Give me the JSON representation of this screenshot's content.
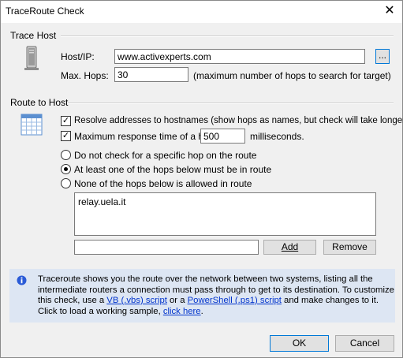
{
  "window": {
    "title": "TraceRoute Check",
    "close_glyph": "✕"
  },
  "trace_host": {
    "section_label": "Trace Host",
    "host_label": "Host/IP:",
    "host_value": "www.activexperts.com",
    "browse_label": "...",
    "hops_label": "Max. Hops:",
    "hops_value": "30",
    "hops_hint": "(maximum number of hops to search for target)"
  },
  "route": {
    "section_label": "Route to Host",
    "resolve_label": "Resolve addresses to hostnames (show hops as names, but check will take longer)",
    "resolve_checked": true,
    "max_time_label": "Maximum response time of a hop:",
    "max_time_checked": true,
    "max_time_value": "500",
    "max_time_unit": "milliseconds.",
    "radio_options": [
      {
        "label": "Do not check for a specific hop on the route",
        "selected": false
      },
      {
        "label": "At least one of the hops below must be in route",
        "selected": true
      },
      {
        "label": "None of the hops below is allowed in route",
        "selected": false
      }
    ],
    "hops_list": [
      "relay.uela.it"
    ],
    "new_hop_value": "",
    "add_label": "Add",
    "remove_label": "Remove"
  },
  "info": {
    "line1": "Traceroute shows you the route over the network between two systems, listing all the",
    "line2": "intermediate routers a connection must pass through to get to its destination. To customize",
    "line3_pre": "this check, use a ",
    "vb_link": "VB (.vbs) script",
    "line3_mid": " or a ",
    "ps_link": "PowerShell (.ps1) script",
    "line3_post": " and make changes to it.",
    "line4_pre": "Click to load a working sample, ",
    "sample_link": "click here",
    "line4_post": "."
  },
  "buttons": {
    "ok_label": "OK",
    "cancel_label": "Cancel"
  }
}
